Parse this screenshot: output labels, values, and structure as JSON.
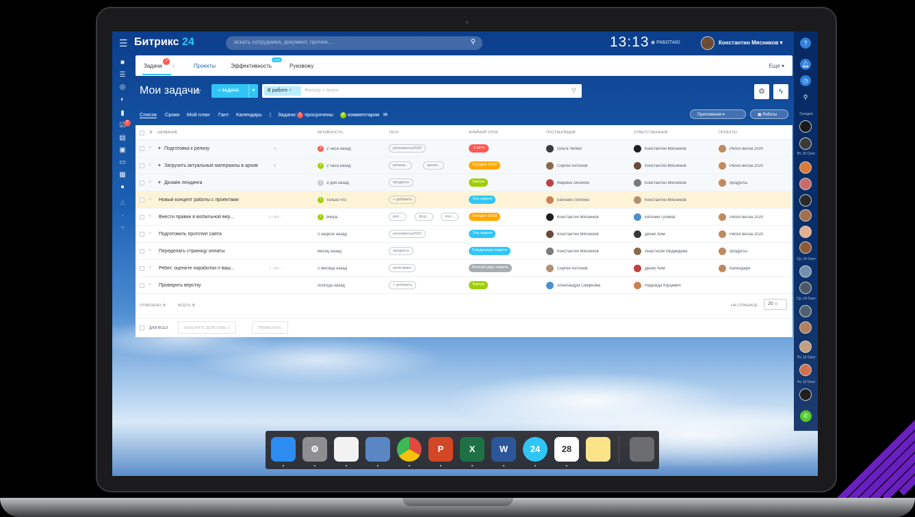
{
  "app": {
    "logo_text": "Битрикс",
    "logo_num": "24",
    "accent": "#2fc6f6",
    "brand_dark": "#08285f"
  },
  "search": {
    "placeholder": "искать сотрудника, документ, прочее..."
  },
  "clock": {
    "time": "13:13",
    "status": "РАБОТАЮ"
  },
  "user": {
    "name": "Константин Мясников"
  },
  "tabs": {
    "tasks": "Задачи",
    "tasks_badge": "7",
    "projects": "Проекты",
    "efficiency": "Эффективность",
    "efficiency_badge": "100%",
    "manager": "Руковожу",
    "more": "Еще"
  },
  "header": {
    "title": "Мои задачи",
    "add_task": "+ ЗАДАЧА",
    "filter_chip": "В работе",
    "filter_placeholder": "Фильтр + поиск"
  },
  "subnav": {
    "list": "Список",
    "deadlines": "Сроки",
    "myplan": "Мой план",
    "gantt": "Гант",
    "calendar": "Календарь",
    "tasks_label": "Задачи:",
    "overdue_count": "1",
    "overdue": "просрочены",
    "comments_count": "6",
    "comments": "комментарии",
    "apps": "Приложения",
    "robots": "Роботы"
  },
  "grid": {
    "columns": [
      "НАЗВАНИЕ",
      "АКТИВНОСТЬ",
      "ТЕГИ",
      "КРАЙНИЙ СРОК",
      "ПОСТАНОВЩИК",
      "ОТВЕТСТВЕННЫЙ",
      "ПРОЕКТЫ"
    ],
    "rows": [
      {
        "name": "Подготовка к релизу",
        "meta": "4",
        "activity": "2 часа назад",
        "act_color": "#ff5752",
        "act_num": "2",
        "tags": [
          "релизвесна2020"
        ],
        "deadline": "-1 день",
        "dl_color": "#ff5752",
        "creator": "Ольга Чепюк",
        "responsible": "Константин Мясников",
        "project": "Релиз весна 2020"
      },
      {
        "name": "Загрузить актуальные материалы в архив",
        "meta": "6",
        "activity": "2 часа назад",
        "act_color": "#9dcf00",
        "act_num": "3",
        "tags": [
          "релизв...",
          "архив..."
        ],
        "deadline": "Сегодня 19:00",
        "dl_color": "#ffa900",
        "creator": "Сергей Антонов",
        "responsible": "Константин Мясников",
        "project": "Релиз весна 2020"
      },
      {
        "name": "Дизайн лендинга",
        "meta": "",
        "activity": "3 дня назад",
        "act_color": "#c6cdd3",
        "act_num": "1",
        "tags": [
          "продукты"
        ],
        "deadline": "Завтра",
        "dl_color": "#9dcf00",
        "creator": "Марина Оксенян",
        "responsible": "Константин Мясников",
        "project": "продукты"
      },
      {
        "name": "Новый концепт работы с проектами",
        "meta": "",
        "activity": "только что",
        "act_color": "#9dcf00",
        "act_num": "1",
        "tags": [
          "+ добавить"
        ],
        "deadline": "Эта неделя",
        "dl_color": "#2fc6f6",
        "creator": "Евгения Петенко",
        "responsible": "Константин Мясников",
        "project": ""
      },
      {
        "name": "Внести правки в мобильной вер...",
        "meta": "3 • 4/6 ...",
        "activity": "вчера",
        "act_color": "#9dcf00",
        "act_num": "1",
        "tags": [
          "рел...",
          "фор...",
          "опл..."
        ],
        "deadline": "Сегодня 19:00",
        "dl_color": "#ffa900",
        "creator": "Константин Мясников",
        "responsible": "Евгений Громов",
        "project": "Релиз весна 2020"
      },
      {
        "name": "Подготовить прототип сайта",
        "meta": "",
        "activity": "2 недели назад",
        "act_color": "",
        "act_num": "",
        "tags": [
          "релизвесна2020"
        ],
        "deadline": "Эта неделя",
        "dl_color": "#2fc6f6",
        "creator": "Константин Мясников",
        "responsible": "Денис Ким",
        "project": "Релиз весна 2020"
      },
      {
        "name": "Переделать страницу оплаты",
        "meta": "",
        "activity": "месяц назад",
        "act_color": "",
        "act_num": "",
        "tags": [
          "продукты"
        ],
        "deadline": "Следующая неделя",
        "dl_color": "#2fc6f6",
        "creator": "Константин Мясников",
        "responsible": "Анастасия Медведева",
        "project": "продукты"
      },
      {
        "name": "Ребят, оцените наработки п ваш...",
        "meta": "7 • 4/9 ...",
        "activity": "2 месяца назад",
        "act_color": "",
        "act_num": "",
        "tags": [
          "календари"
        ],
        "deadline": "Больше двух недель",
        "dl_color": "#a8adb4",
        "creator": "Сергей Антонов",
        "responsible": "Денис Ким",
        "project": "Календари"
      },
      {
        "name": "Проверить верстку",
        "meta": "",
        "activity": "полгода назад",
        "act_color": "",
        "act_num": "",
        "tags": [
          "+ добавить"
        ],
        "deadline": "Завтра",
        "dl_color": "#9dcf00",
        "creator": "Александра Смирнова",
        "responsible": "Надежда Юрцевич",
        "project": ""
      }
    ],
    "footer": {
      "selected_label": "ОТМЕЧЕНО:",
      "selected": "0",
      "total_label": "ВСЕГО:",
      "total": "9",
      "per_page_label": "НА СТРАНИЦЕ:",
      "per_page": "20"
    },
    "actions": {
      "for_all": "ДЛЯ ВСЕХ",
      "choose": "ВЫБЕРИТЕ ДЕЙСТВИЕ",
      "apply": "ПРИМЕНИТЬ"
    }
  },
  "rightbar": {
    "dates": [
      "Сегодня",
      "Вт, 15 Сент",
      "Ср, 14 Сент",
      "Пт, 13 Сент",
      "Чт, 12 Сент"
    ]
  },
  "dock": {
    "apps": [
      {
        "name": "finder",
        "label": "",
        "color": "#2d8cf0"
      },
      {
        "name": "system-preferences",
        "label": "⚙",
        "color": "#8e8e93"
      },
      {
        "name": "textedit",
        "label": "",
        "color": "#f2f2f2"
      },
      {
        "name": "preview",
        "label": "",
        "color": "#5a86c4"
      },
      {
        "name": "chrome",
        "label": "",
        "color": "#e04a3f"
      },
      {
        "name": "powerpoint",
        "label": "P",
        "color": "#d24726"
      },
      {
        "name": "excel",
        "label": "X",
        "color": "#1e7145"
      },
      {
        "name": "word",
        "label": "W",
        "color": "#2b579a"
      },
      {
        "name": "bitrix24",
        "label": "24",
        "color": "#2fc6f6"
      },
      {
        "name": "calendar",
        "label": "28",
        "color": "#ffffff"
      },
      {
        "name": "notes",
        "label": "",
        "color": "#fbe38a"
      },
      {
        "name": "trash",
        "label": "",
        "color": "#6b6b70"
      }
    ]
  }
}
